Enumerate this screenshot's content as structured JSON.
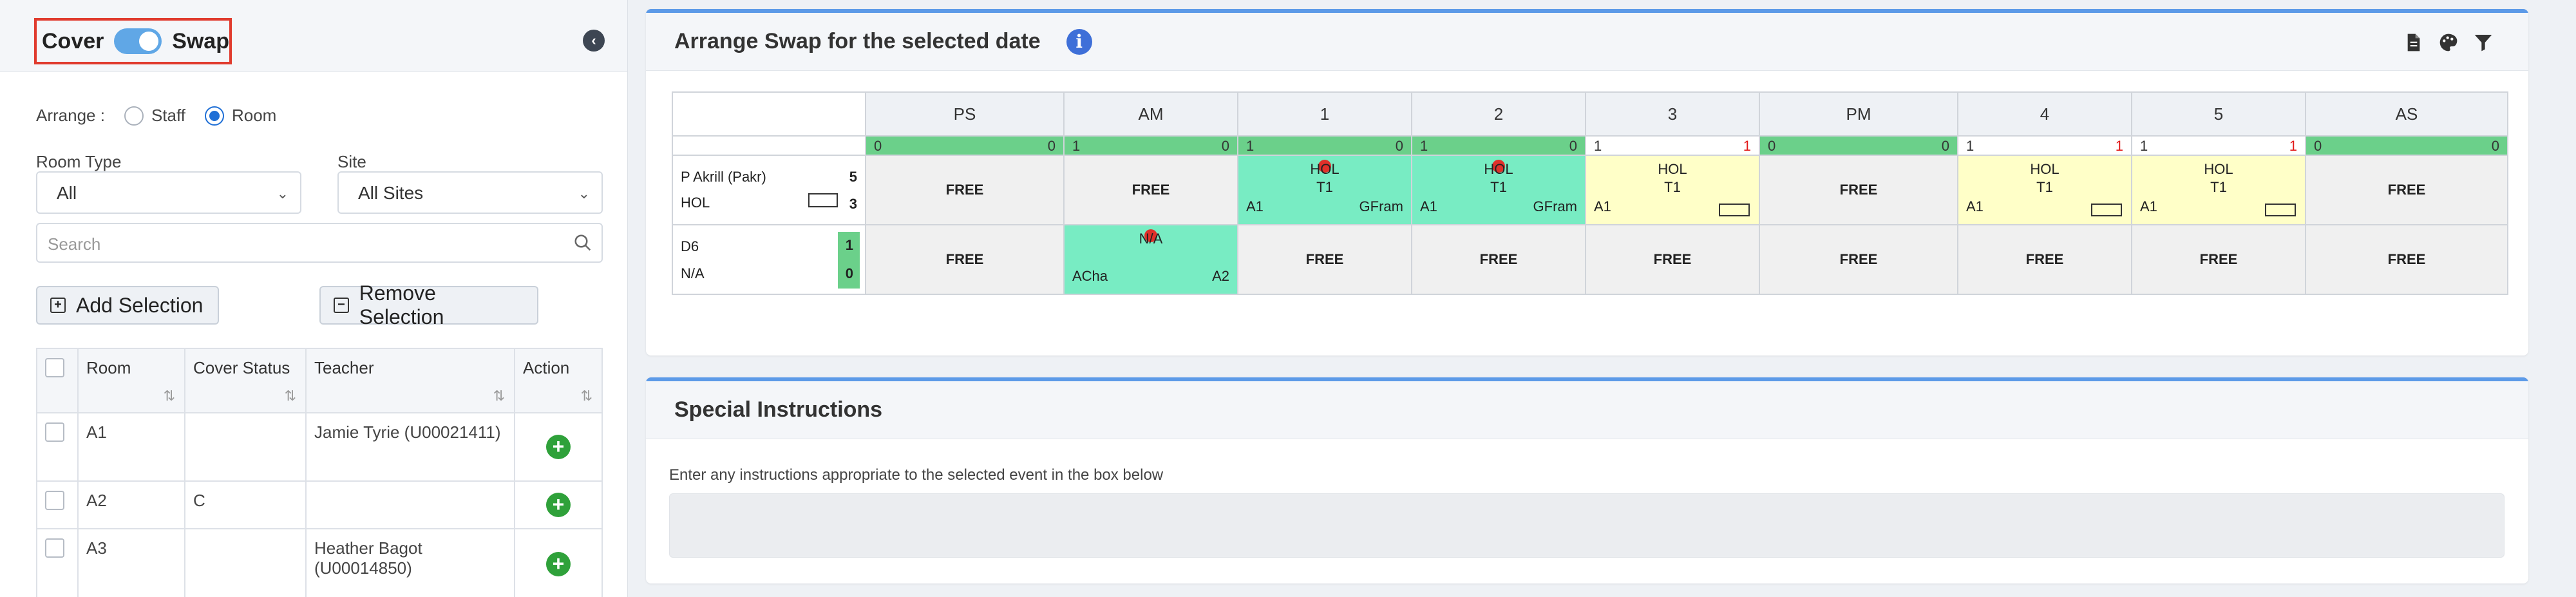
{
  "mode": {
    "cover_label": "Cover",
    "swap_label": "Swap",
    "swap_on": true
  },
  "collapse_icon": "chevron-left-icon",
  "arrange": {
    "label": "Arrange :",
    "options": [
      "Staff",
      "Room"
    ],
    "selected": "Room"
  },
  "room_type": {
    "label": "Room Type",
    "value": "All"
  },
  "site": {
    "label": "Site",
    "value": "All Sites"
  },
  "search": {
    "placeholder": "Search"
  },
  "buttons": {
    "add_selection": "Add Selection",
    "remove_selection": "Remove Selection"
  },
  "room_table": {
    "headers": [
      "Room",
      "Cover Status",
      "Teacher",
      "Action"
    ],
    "rows": [
      {
        "room": "A1",
        "cover_status": "",
        "teacher": "Jamie Tyrie (U00021411)"
      },
      {
        "room": "A2",
        "cover_status": "C",
        "teacher": ""
      },
      {
        "room": "A3",
        "cover_status": "",
        "teacher": "Heather Bagot (U00014850)"
      }
    ]
  },
  "arrange_panel": {
    "title": "Arrange Swap for the selected date",
    "periods": [
      "PS",
      "AM",
      "1",
      "2",
      "3",
      "PM",
      "4",
      "5",
      "AS"
    ],
    "status": [
      {
        "left": "0",
        "right": "0",
        "tone": "green"
      },
      {
        "left": "1",
        "right": "0",
        "tone": "green"
      },
      {
        "left": "1",
        "right": "0",
        "tone": "green"
      },
      {
        "left": "1",
        "right": "0",
        "tone": "green"
      },
      {
        "left": "1",
        "right": "1",
        "tone": "white"
      },
      {
        "left": "0",
        "right": "0",
        "tone": "green"
      },
      {
        "left": "1",
        "right": "1",
        "tone": "white"
      },
      {
        "left": "1",
        "right": "1",
        "tone": "white"
      },
      {
        "left": "0",
        "right": "0",
        "tone": "green"
      }
    ],
    "teacher_row": {
      "name": "P Akrill (Pakr)",
      "sub": "HOL",
      "stat1": "5",
      "stat2": "3",
      "cells": [
        {
          "type": "free",
          "label": "FREE"
        },
        {
          "type": "free",
          "label": "FREE"
        },
        {
          "type": "mint",
          "c1": "HOL",
          "c2": "T1",
          "bl": "A1",
          "br": "GFram",
          "pin": true
        },
        {
          "type": "mint",
          "c1": "HOL",
          "c2": "T1",
          "bl": "A1",
          "br": "GFram",
          "pin": true
        },
        {
          "type": "yellow",
          "c1": "HOL",
          "c2": "T1",
          "bl": "A1",
          "box": true
        },
        {
          "type": "free",
          "label": "FREE"
        },
        {
          "type": "yellow",
          "c1": "HOL",
          "c2": "T1",
          "bl": "A1",
          "box": true
        },
        {
          "type": "yellow",
          "c1": "HOL",
          "c2": "T1",
          "bl": "A1",
          "box": true
        },
        {
          "type": "free",
          "label": "FREE"
        }
      ]
    },
    "room_row": {
      "name": "D6",
      "sub": "N/A",
      "stat1": "1",
      "stat2": "0",
      "cells": [
        {
          "type": "free",
          "label": "FREE"
        },
        {
          "type": "mint",
          "c1": "N/A",
          "c2": "",
          "bl": "ACha",
          "br": "A2",
          "pin": true
        },
        {
          "type": "free",
          "label": "FREE"
        },
        {
          "type": "free",
          "label": "FREE"
        },
        {
          "type": "free",
          "label": "FREE"
        },
        {
          "type": "free",
          "label": "FREE"
        },
        {
          "type": "free",
          "label": "FREE"
        },
        {
          "type": "free",
          "label": "FREE"
        },
        {
          "type": "free",
          "label": "FREE"
        }
      ]
    }
  },
  "special_instructions": {
    "title": "Special Instructions",
    "hint": "Enter any instructions appropriate to the selected event in the box below"
  },
  "colors": {
    "accent": "#5c9ae8",
    "green": "#6bd08a",
    "mint": "#78ecc3",
    "yellow": "#ffffc8",
    "highlight_border": "#e03b2e"
  }
}
